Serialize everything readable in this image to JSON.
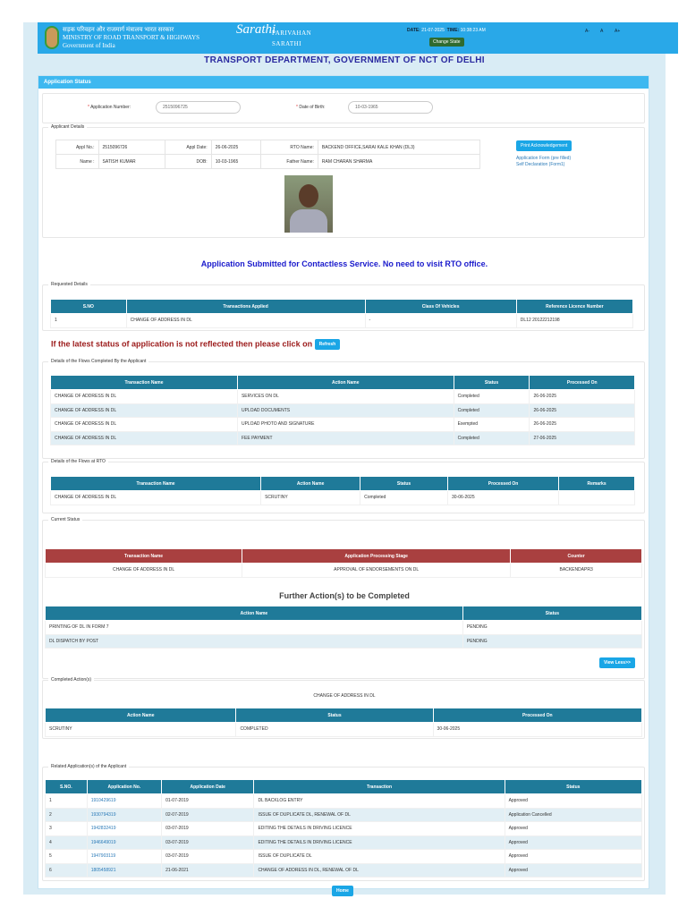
{
  "header": {
    "ministry_hindi": "सड़क परिवहन और राजमार्ग मंत्रालय भारत सरकार",
    "ministry": "MINISTRY OF ROAD TRANSPORT & HIGHWAYS",
    "gov": "Government of India",
    "logo_text": "Sarathi",
    "parivahan": "PARIVAHAN",
    "sarathi": "SARATHI",
    "date_label": "DATE:",
    "date": "21-07-2025",
    "time_label": "TIME:",
    "time": "10:38:23 AM",
    "change_state": "Change State",
    "font_small": "A-",
    "font_normal": "A",
    "font_large": "A+"
  },
  "dept_title": "TRANSPORT DEPARTMENT, GOVERNMENT OF NCT OF DELHI",
  "panel_title": "Application Status",
  "form": {
    "app_no_label": "Application Number:",
    "app_no": "2515096725",
    "dob_label": "Date of Birth:",
    "dob": "10-03-1965"
  },
  "applicant": {
    "legend": "Applicant Details",
    "appl_no_label": "Appl No.:",
    "appl_no": "2515096726",
    "appl_date_label": "Appl Date:",
    "appl_date": "26-06-2025",
    "rto_label": "RTO Name:",
    "rto": "BACKEND OFFICE,SARAI KALE KHAN (DL3)",
    "name_label": "Name :",
    "name": "SATISH KUMAR",
    "dob_label": "DOB:",
    "dob": "10-03-1965",
    "father_label": "Father Name:",
    "father": "RAM CHARAN SHARMA",
    "print_ack": "Print Acknowledgement",
    "app_form": "Application Form (pre filled)",
    "self_decl": "Self Declaration (Form1)"
  },
  "contactless_msg": "Application Submitted for Contactless Service. No need to visit RTO office.",
  "requested": {
    "legend": "Requested Details",
    "headers": [
      "S.NO",
      "Transactions Applied",
      "Class Of Vehicles",
      "Reference Licence Number"
    ],
    "rows": [
      [
        "1",
        "CHANGE OF ADDRESS IN DL",
        "-",
        "DL12 20122212198"
      ]
    ]
  },
  "refresh_msg": "If the latest status of application is not reflected then please click on",
  "refresh": "Refresh",
  "flows_applicant": {
    "legend": "Details of the Flows Completed By the Applicant",
    "headers": [
      "Transaction Name",
      "Action Name",
      "Status",
      "Processed On"
    ],
    "rows": [
      [
        "CHANGE OF ADDRESS IN DL",
        "SERVICES ON DL",
        "Completed",
        "26-06-2025"
      ],
      [
        "CHANGE OF ADDRESS IN DL",
        "UPLOAD DOCUMENTS",
        "Completed",
        "26-06-2025"
      ],
      [
        "CHANGE OF ADDRESS IN DL",
        "UPLOAD PHOTO AND SIGNATURE",
        "Exempted",
        "26-06-2025"
      ],
      [
        "CHANGE OF ADDRESS IN DL",
        "FEE PAYMENT",
        "Completed",
        "27-06-2025"
      ]
    ]
  },
  "flows_rto": {
    "legend": "Details of the Flows at RTO",
    "headers": [
      "Transaction Name",
      "Action Name",
      "Status",
      "Processed On",
      "Remarks"
    ],
    "rows": [
      [
        "CHANGE OF ADDRESS IN DL",
        "SCRUTINY",
        "Completed",
        "30-06-2025",
        ""
      ]
    ]
  },
  "current": {
    "legend": "Current Status",
    "headers": [
      "Transaction Name",
      "Application Processing Stage",
      "Counter"
    ],
    "rows": [
      [
        "CHANGE OF ADDRESS IN DL",
        "APPROVAL OF ENDORSEMENTS ON DL",
        "BACKENDAPR3"
      ]
    ]
  },
  "further": {
    "title": "Further Action(s) to be Completed",
    "headers": [
      "Action Name",
      "Status"
    ],
    "rows": [
      [
        "PRINTING OF DL IN FORM 7",
        "PENDING"
      ],
      [
        "DL DISPATCH BY POST",
        "PENDING"
      ]
    ],
    "view_less": "View Less>>"
  },
  "completed": {
    "legend": "Completed Action(s)",
    "transaction": "CHANGE OF ADDRESS IN DL",
    "headers": [
      "Action Name",
      "Status",
      "Processed On"
    ],
    "rows": [
      [
        "SCRUTINY",
        "COMPLETED",
        "30-06-2025"
      ]
    ]
  },
  "related": {
    "legend": "Related Application(s) of the Applicant",
    "headers": [
      "S.NO.",
      "Application No.",
      "Application Date",
      "Transaction",
      "Status"
    ],
    "rows": [
      [
        "1",
        "1910429619",
        "01-07-2019",
        "DL BACKLOG ENTRY",
        "Approved"
      ],
      [
        "2",
        "1930794319",
        "02-07-2019",
        "ISSUE OF DUPLICATE DL, RENEWAL OF DL",
        "Application Cancelled"
      ],
      [
        "3",
        "1942832419",
        "03-07-2019",
        "EDITING THE DETAILS IN DRIVING LICENCE",
        "Approved"
      ],
      [
        "4",
        "1946649019",
        "03-07-2019",
        "EDITING THE DETAILS IN DRIVING LICENCE",
        "Approved"
      ],
      [
        "5",
        "1947903119",
        "03-07-2019",
        "ISSUE OF DUPLICATE DL",
        "Approved"
      ],
      [
        "6",
        "1805458921",
        "21-06-2021",
        "CHANGE OF ADDRESS IN DL, RENEWAL OF DL",
        "Approved"
      ]
    ]
  },
  "home": "Home"
}
